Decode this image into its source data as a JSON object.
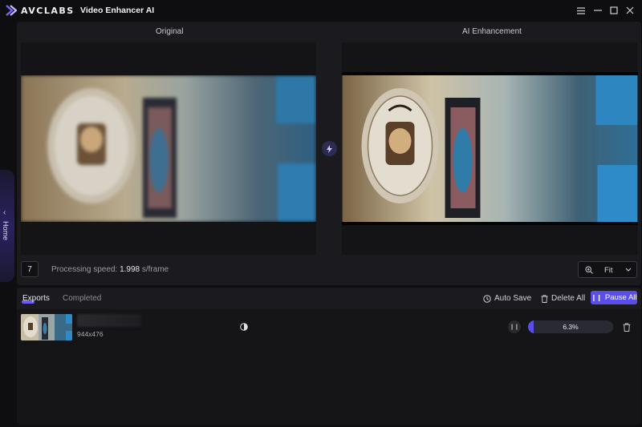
{
  "titlebar": {
    "brand": "AVCLABS",
    "app_name": "Video Enhancer AI"
  },
  "sidebar": {
    "home_label": "Home"
  },
  "preview": {
    "left_title": "Original",
    "right_title": "AI Enhancement",
    "frame_value": "7",
    "speed_label": "Processing speed: ",
    "speed_value": "1.998",
    "speed_unit": " s/frame",
    "zoom_value": "Fit"
  },
  "exports": {
    "tabs": [
      "Exports",
      "Completed"
    ],
    "auto_save_label": "Auto Save",
    "delete_all_label": "Delete All",
    "pause_all_label": "Pause All",
    "items": [
      {
        "resolution": "944x476",
        "progress_text": "6.3%",
        "progress": 0.063
      }
    ]
  },
  "colors": {
    "accent": "#5a4ee8",
    "panel": "#1b1b1f",
    "background": "#0e0e10"
  }
}
